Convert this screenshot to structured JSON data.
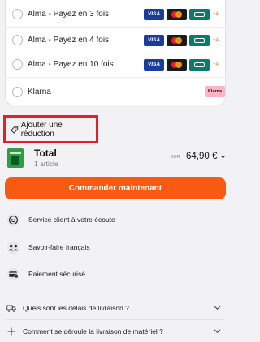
{
  "payment_options": [
    {
      "label": "Alma - Payez en 3 fois",
      "more": "+4"
    },
    {
      "label": "Alma - Payez en 4 fois",
      "more": "+4"
    },
    {
      "label": "Alma - Payez en 10 fois",
      "more": "+4"
    },
    {
      "label": "Klarna"
    }
  ],
  "card_logos": {
    "visa": "VISA",
    "klarna": "Klarna"
  },
  "discount": {
    "label": "Ajouter une réduction"
  },
  "summary": {
    "total_label": "Total",
    "article_count": "1 article",
    "currency_code": "EUR",
    "price": "64,90 €"
  },
  "cta": {
    "label": "Commander maintenant",
    "color": "#f85a11"
  },
  "features": [
    {
      "label": "Service client à votre écoute",
      "icon": "smiley-icon"
    },
    {
      "label": "Savoir-faire français",
      "icon": "team-icon"
    },
    {
      "label": "Paiement sécurisé",
      "icon": "secure-card-icon"
    }
  ],
  "faq": [
    {
      "label": "Quels sont les délais de livraison ?",
      "icon": "truck-icon"
    },
    {
      "label": "Comment se déroule la livraison de matériel ?",
      "icon": "plus-icon"
    }
  ],
  "colors": {
    "accent": "#f85a11",
    "highlight_border": "#e0212b"
  }
}
